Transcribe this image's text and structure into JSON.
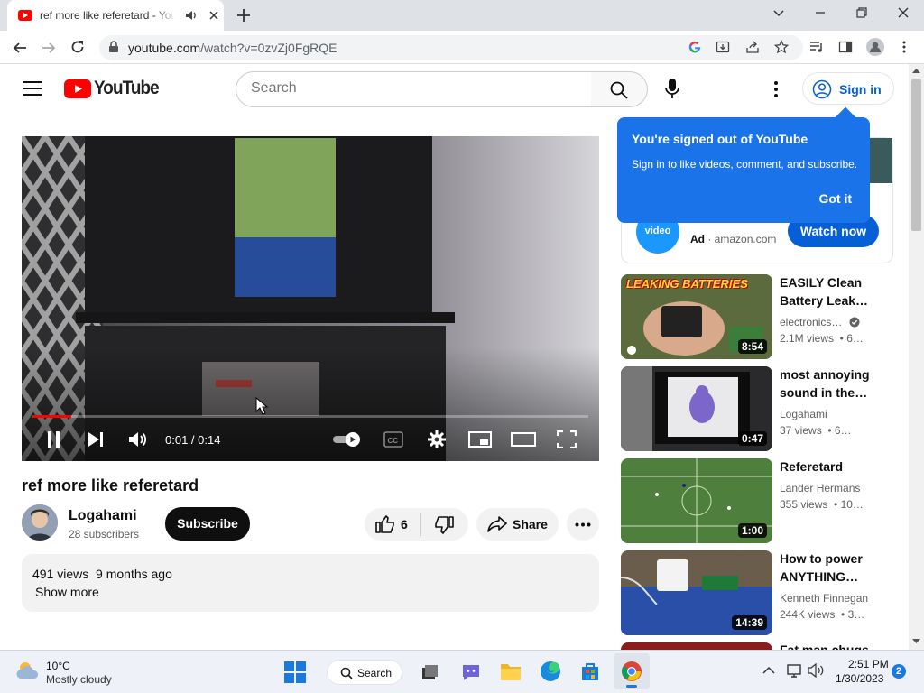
{
  "browser": {
    "tab_title": "ref more like referetard - YouTube",
    "url_main": "youtube.com",
    "url_path": "/watch?v=0zvZj0FgRQE"
  },
  "masthead": {
    "logo": "YouTube",
    "search_placeholder": "Search",
    "signin_label": "Sign in"
  },
  "player": {
    "time": "0:01 / 0:14",
    "progress": 0.07
  },
  "video": {
    "title": "ref more like referetard",
    "channel": "Logahami",
    "subscribers": "28 subscribers",
    "subscribe_label": "Subscribe",
    "likes": "6",
    "share_label": "Share",
    "views_date": "491 views  9 months ago",
    "show_more": "Show more"
  },
  "tooltip": {
    "title": "You're signed out of YouTube",
    "body": "Sign in to like videos, comment, and subscribe.",
    "button": "Got it"
  },
  "ad": {
    "badge": "Ad",
    "domain": "amazon.com",
    "logo_text": "video",
    "cta": "Watch now"
  },
  "recommendations": [
    {
      "title": "EASILY Clean Battery Leak…",
      "channel": "electronics…",
      "meta": "2.1M views  • 6…",
      "duration": "8:54",
      "thumb_text": "LEAKING BATTERIES"
    },
    {
      "title": "most annoying sound in the…",
      "channel": "Logahami",
      "meta": "37 views  • 6…",
      "duration": "0:47"
    },
    {
      "title": "Referetard",
      "channel": "Lander Hermans",
      "meta": "355 views  • 10…",
      "duration": "1:00"
    },
    {
      "title": "How to power ANYTHING…",
      "channel": "Kenneth Finnegan",
      "meta": "244K views  • 3…",
      "duration": "14:39"
    },
    {
      "title": "Fat man chugs"
    }
  ],
  "taskbar": {
    "temperature": "10°C",
    "weather": "Mostly cloudy",
    "search_label": "Search",
    "time": "2:51 PM",
    "date": "1/30/2023",
    "notifications": "2"
  }
}
